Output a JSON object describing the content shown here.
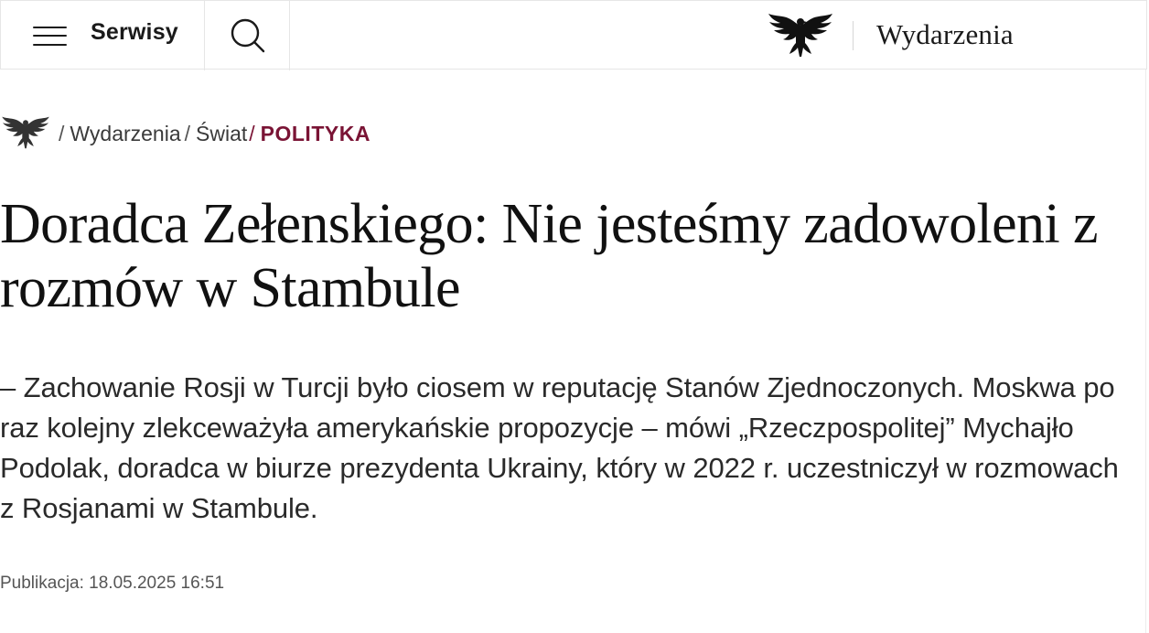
{
  "header": {
    "menu_label": "Serwisy",
    "section_label": "Wydarzenia",
    "icons": {
      "menu": "hamburger-icon",
      "search": "search-icon",
      "logo": "eagle-logo-icon"
    }
  },
  "breadcrumb": {
    "items": [
      "Wydarzenia",
      "Świat"
    ],
    "current": "POLITYKA",
    "separator": "/"
  },
  "article": {
    "title": "Doradca Zełenskiego: Nie jesteśmy zadowoleni z rozmów w Stambule",
    "lead": "– Zachowanie Rosji w Turcji było ciosem w reputację Stanów Zjednoczonych. Moskwa po raz kolejny zlekceważyła amerykańskie propozycje – mówi „Rzeczpospolitej” Mychajło Podolak, doradca w biurze prezydenta Ukrainy, który w 2022 r. uczestniczył w rozmowach z Rosjanami w Stambule.",
    "published": "Publikacja: 18.05.2025 16:51"
  },
  "colors": {
    "accent": "#7a1435",
    "text": "#1a1a1a",
    "border": "#e6e6e6"
  }
}
